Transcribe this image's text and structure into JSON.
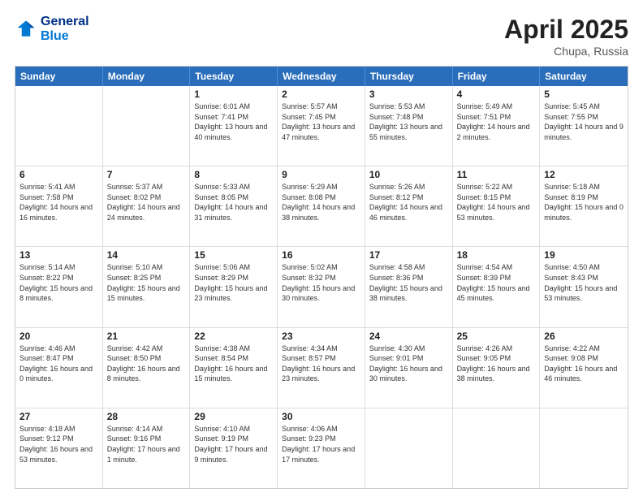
{
  "header": {
    "logo_line1": "General",
    "logo_line2": "Blue",
    "month": "April 2025",
    "location": "Chupa, Russia"
  },
  "weekdays": [
    "Sunday",
    "Monday",
    "Tuesday",
    "Wednesday",
    "Thursday",
    "Friday",
    "Saturday"
  ],
  "rows": [
    [
      {
        "day": "",
        "text": ""
      },
      {
        "day": "",
        "text": ""
      },
      {
        "day": "1",
        "text": "Sunrise: 6:01 AM\nSunset: 7:41 PM\nDaylight: 13 hours and 40 minutes."
      },
      {
        "day": "2",
        "text": "Sunrise: 5:57 AM\nSunset: 7:45 PM\nDaylight: 13 hours and 47 minutes."
      },
      {
        "day": "3",
        "text": "Sunrise: 5:53 AM\nSunset: 7:48 PM\nDaylight: 13 hours and 55 minutes."
      },
      {
        "day": "4",
        "text": "Sunrise: 5:49 AM\nSunset: 7:51 PM\nDaylight: 14 hours and 2 minutes."
      },
      {
        "day": "5",
        "text": "Sunrise: 5:45 AM\nSunset: 7:55 PM\nDaylight: 14 hours and 9 minutes."
      }
    ],
    [
      {
        "day": "6",
        "text": "Sunrise: 5:41 AM\nSunset: 7:58 PM\nDaylight: 14 hours and 16 minutes."
      },
      {
        "day": "7",
        "text": "Sunrise: 5:37 AM\nSunset: 8:02 PM\nDaylight: 14 hours and 24 minutes."
      },
      {
        "day": "8",
        "text": "Sunrise: 5:33 AM\nSunset: 8:05 PM\nDaylight: 14 hours and 31 minutes."
      },
      {
        "day": "9",
        "text": "Sunrise: 5:29 AM\nSunset: 8:08 PM\nDaylight: 14 hours and 38 minutes."
      },
      {
        "day": "10",
        "text": "Sunrise: 5:26 AM\nSunset: 8:12 PM\nDaylight: 14 hours and 46 minutes."
      },
      {
        "day": "11",
        "text": "Sunrise: 5:22 AM\nSunset: 8:15 PM\nDaylight: 14 hours and 53 minutes."
      },
      {
        "day": "12",
        "text": "Sunrise: 5:18 AM\nSunset: 8:19 PM\nDaylight: 15 hours and 0 minutes."
      }
    ],
    [
      {
        "day": "13",
        "text": "Sunrise: 5:14 AM\nSunset: 8:22 PM\nDaylight: 15 hours and 8 minutes."
      },
      {
        "day": "14",
        "text": "Sunrise: 5:10 AM\nSunset: 8:25 PM\nDaylight: 15 hours and 15 minutes."
      },
      {
        "day": "15",
        "text": "Sunrise: 5:06 AM\nSunset: 8:29 PM\nDaylight: 15 hours and 23 minutes."
      },
      {
        "day": "16",
        "text": "Sunrise: 5:02 AM\nSunset: 8:32 PM\nDaylight: 15 hours and 30 minutes."
      },
      {
        "day": "17",
        "text": "Sunrise: 4:58 AM\nSunset: 8:36 PM\nDaylight: 15 hours and 38 minutes."
      },
      {
        "day": "18",
        "text": "Sunrise: 4:54 AM\nSunset: 8:39 PM\nDaylight: 15 hours and 45 minutes."
      },
      {
        "day": "19",
        "text": "Sunrise: 4:50 AM\nSunset: 8:43 PM\nDaylight: 15 hours and 53 minutes."
      }
    ],
    [
      {
        "day": "20",
        "text": "Sunrise: 4:46 AM\nSunset: 8:47 PM\nDaylight: 16 hours and 0 minutes."
      },
      {
        "day": "21",
        "text": "Sunrise: 4:42 AM\nSunset: 8:50 PM\nDaylight: 16 hours and 8 minutes."
      },
      {
        "day": "22",
        "text": "Sunrise: 4:38 AM\nSunset: 8:54 PM\nDaylight: 16 hours and 15 minutes."
      },
      {
        "day": "23",
        "text": "Sunrise: 4:34 AM\nSunset: 8:57 PM\nDaylight: 16 hours and 23 minutes."
      },
      {
        "day": "24",
        "text": "Sunrise: 4:30 AM\nSunset: 9:01 PM\nDaylight: 16 hours and 30 minutes."
      },
      {
        "day": "25",
        "text": "Sunrise: 4:26 AM\nSunset: 9:05 PM\nDaylight: 16 hours and 38 minutes."
      },
      {
        "day": "26",
        "text": "Sunrise: 4:22 AM\nSunset: 9:08 PM\nDaylight: 16 hours and 46 minutes."
      }
    ],
    [
      {
        "day": "27",
        "text": "Sunrise: 4:18 AM\nSunset: 9:12 PM\nDaylight: 16 hours and 53 minutes."
      },
      {
        "day": "28",
        "text": "Sunrise: 4:14 AM\nSunset: 9:16 PM\nDaylight: 17 hours and 1 minute."
      },
      {
        "day": "29",
        "text": "Sunrise: 4:10 AM\nSunset: 9:19 PM\nDaylight: 17 hours and 9 minutes."
      },
      {
        "day": "30",
        "text": "Sunrise: 4:06 AM\nSunset: 9:23 PM\nDaylight: 17 hours and 17 minutes."
      },
      {
        "day": "",
        "text": ""
      },
      {
        "day": "",
        "text": ""
      },
      {
        "day": "",
        "text": ""
      }
    ]
  ]
}
